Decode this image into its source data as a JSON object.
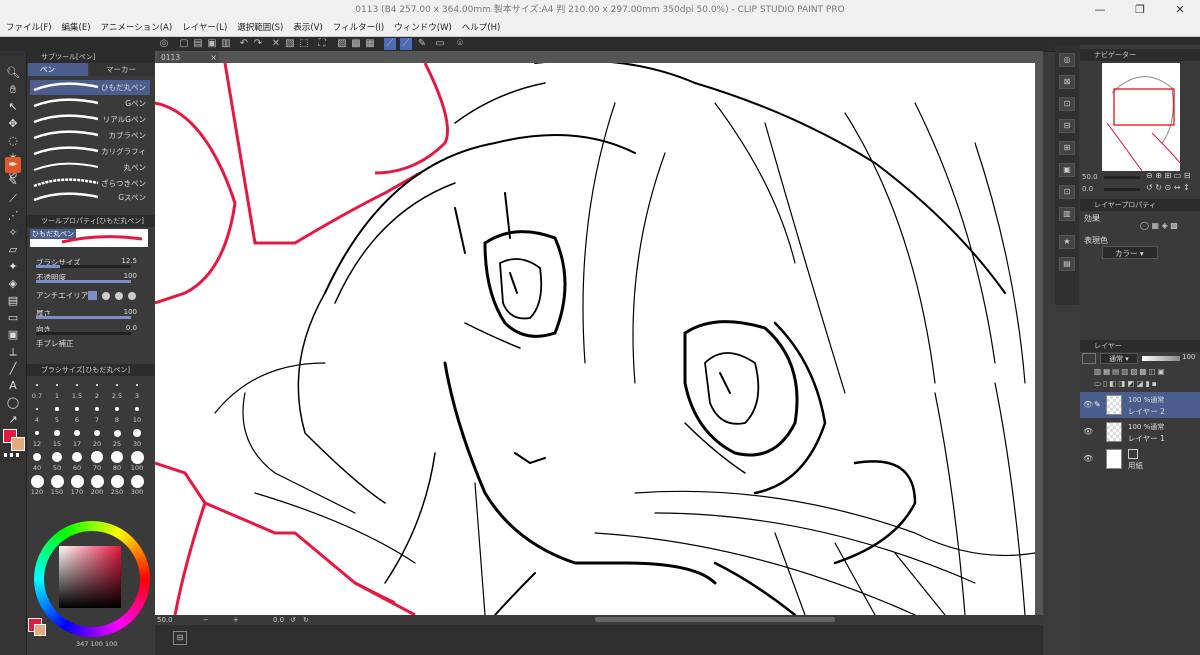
{
  "window": {
    "title": "0113 (B4 257.00 x 364.00mm 製本サイズ:A4 判 210.00 x 297.00mm 350dpi 50.0%) - CLIP STUDIO PAINT PRO",
    "controls": [
      "—",
      "❐",
      "✕"
    ]
  },
  "menu": [
    "ファイル(F)",
    "編集(E)",
    "アニメーション(A)",
    "レイヤー(L)",
    "選択範囲(S)",
    "表示(V)",
    "フィルター(I)",
    "ウィンドウ(W)",
    "ヘルプ(H)"
  ],
  "subtool": {
    "header": "サブツール[ペン]",
    "tabs": [
      "ペン",
      "マーカー"
    ],
    "brushes": [
      "ひもだ丸ペン",
      "Gペン",
      "リアルGペン",
      "カブラペン",
      "カリグラフィ",
      "丸ペン",
      "ざらつきペン",
      "Gスペン"
    ]
  },
  "toolprop": {
    "header": "ツールプロパティ[ひもだ丸ペン]",
    "name": "ひもだ丸ペン",
    "rows": [
      {
        "label": "ブラシサイズ",
        "value": "12.5",
        "fill": 0.25
      },
      {
        "label": "不透明度",
        "value": "100",
        "fill": 1.0
      },
      {
        "label": "アンチエイリアス",
        "value": "",
        "fill": 0
      },
      {
        "label": "厚さ",
        "value": "100",
        "fill": 1.0
      },
      {
        "label": "向き",
        "value": "0.0",
        "fill": 0
      },
      {
        "label": "手ブレ補正",
        "value": "",
        "fill": 0
      }
    ]
  },
  "brushsize": {
    "header": "ブラシサイズ[ひもだ丸ペン]",
    "sizes": [
      "0.7",
      "1",
      "1.5",
      "2",
      "2.5",
      "3",
      "4",
      "5",
      "6",
      "7",
      "8",
      "10",
      "12",
      "15",
      "17",
      "20",
      "25",
      "30",
      "40",
      "50",
      "60",
      "70",
      "80",
      "100",
      "120",
      "150",
      "170",
      "200",
      "250",
      "300"
    ]
  },
  "color": {
    "main": "#e8173f",
    "sub": "#e8aa7a",
    "values": [
      "347",
      "100",
      "100"
    ]
  },
  "canvas": {
    "tab": "0113",
    "zoom": "50.0",
    "angle": "0.0"
  },
  "navigator": {
    "header": "ナビゲーター",
    "zoom": "50.0",
    "angle": "0.0"
  },
  "layerprop": {
    "header": "レイヤープロパティ",
    "effect_label": "効果",
    "color_label": "表現色",
    "color_value": "カラー"
  },
  "layers": {
    "header": "レイヤー",
    "blend": "通常",
    "opacity": "100",
    "items": [
      {
        "mode": "100 %通常",
        "name": "レイヤー 2",
        "selected": true
      },
      {
        "mode": "100 %通常",
        "name": "レイヤー 1",
        "selected": false
      },
      {
        "mode": "",
        "name": "用紙",
        "selected": false
      }
    ]
  }
}
